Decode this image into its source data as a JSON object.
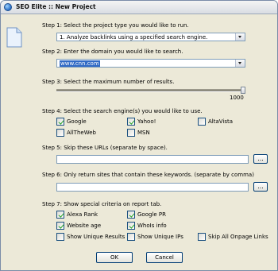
{
  "window": {
    "title": "SEO Elite :: New Project"
  },
  "step1": {
    "label": "Step 1: Select the project type you would like to run.",
    "selected": "1. Analyze backlinks using a specified search engine."
  },
  "step2": {
    "label": "Step 2: Enter the domain you would like to search.",
    "value": "www.cnn.com"
  },
  "step3": {
    "label": "Step 3: Select the maximum number of results.",
    "value": "1000",
    "level": 1.0
  },
  "step4": {
    "label": "Step 4: Select the search engine(s) you would like to use.",
    "engines": [
      {
        "label": "Google",
        "checked": true
      },
      {
        "label": "Yahoo!",
        "checked": true
      },
      {
        "label": "AltaVista",
        "checked": false
      },
      {
        "label": "AllTheWeb",
        "checked": false
      },
      {
        "label": "MSN",
        "checked": false
      }
    ]
  },
  "step5": {
    "label": "Step 5: Skip these URLs (separate by space).",
    "value": "",
    "browse_label": "..."
  },
  "step6": {
    "label": "Step 6: Only return sites that contain these keywords. (separate by comma)",
    "value": "",
    "browse_label": "..."
  },
  "step7": {
    "label": "Step 7: Show special criteria on report tab.",
    "options": [
      {
        "label": "Alexa Rank",
        "checked": true
      },
      {
        "label": "Google PR",
        "checked": true
      },
      {
        "label": "Website age",
        "checked": true
      },
      {
        "label": "WhoIs info",
        "checked": true
      },
      {
        "label": "Show Unique Results",
        "checked": false
      },
      {
        "label": "Show Unique IPs",
        "checked": false
      },
      {
        "label": "Skip All Onpage Links",
        "checked": false
      }
    ]
  },
  "buttons": {
    "ok": "OK",
    "cancel": "Cancel"
  }
}
